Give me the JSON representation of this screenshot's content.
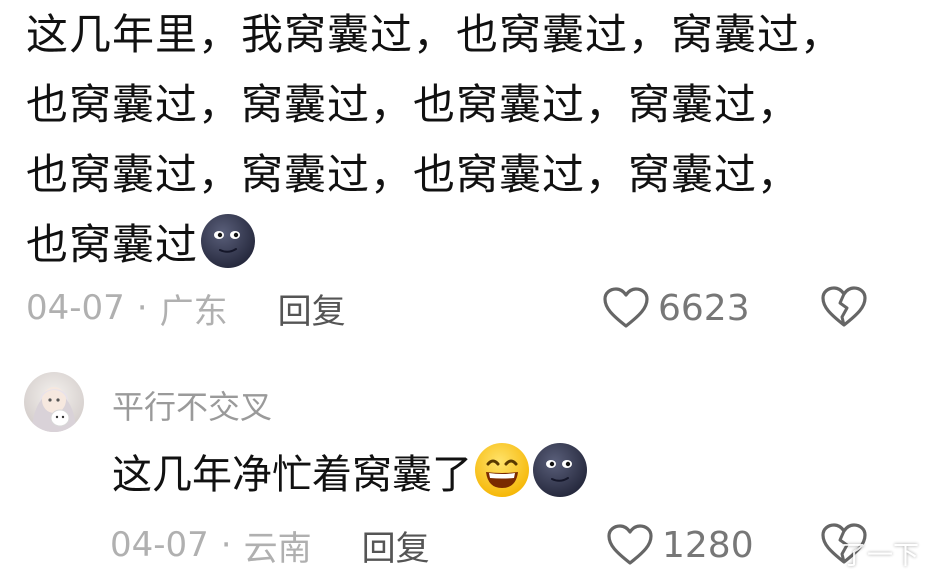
{
  "comment": {
    "lines": [
      "这几年里，我窝囊过，也窝囊过，窝囊过，",
      "也窝囊过，窝囊过，也窝囊过，窝囊过，",
      "也窝囊过，窝囊过，也窝囊过，窝囊过，",
      "也窝囊过"
    ],
    "emoji": "new-moon-face-emoji",
    "date": "04-07",
    "separator": "·",
    "location": "广东",
    "reply_label": "回复",
    "like_count": "6623"
  },
  "reply": {
    "username": "平行不交叉",
    "text": "这几年净忙着窝囊了",
    "emojis": [
      "grinning-face-emoji",
      "new-moon-face-emoji"
    ],
    "date": "04-07",
    "separator": "·",
    "location": "云南",
    "reply_label": "回复",
    "like_count": "1280"
  },
  "overlay": {
    "watermark": "了一下"
  },
  "colors": {
    "text": "#111111",
    "meta": "#b0b0b0",
    "reply_action": "#555555",
    "icon": "#666666"
  }
}
